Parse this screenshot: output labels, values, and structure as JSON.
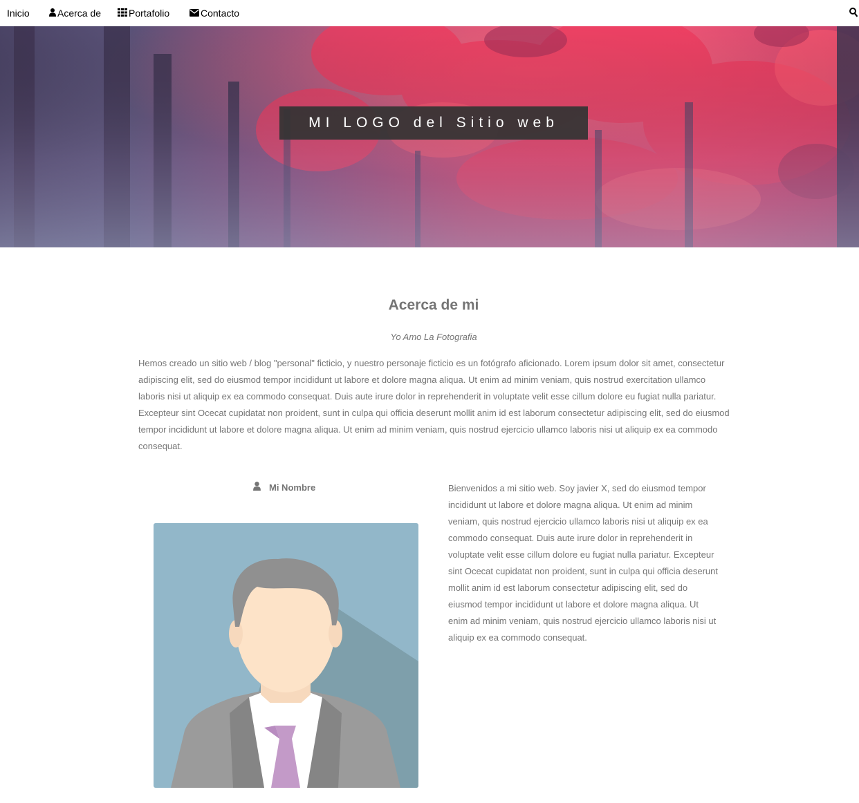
{
  "nav": {
    "items": [
      {
        "label": "Inicio",
        "icon": ""
      },
      {
        "label": "Acerca de",
        "icon": "user-icon"
      },
      {
        "label": "Portafolio",
        "icon": "grid-icon"
      },
      {
        "label": "Contacto",
        "icon": "envelope-icon"
      }
    ],
    "search_icon": "search-icon"
  },
  "hero": {
    "logo_text": "MI LOGO del Sitio web"
  },
  "about": {
    "title": "Acerca de mi",
    "subtitle": "Yo Amo La Fotografia",
    "intro": "Hemos creado un sitio web / blog \"personal\" ficticio, y nuestro personaje ficticio es un fotógrafo aficionado. Lorem ipsum dolor sit amet, consectetur adipiscing elit, sed do eiusmod tempor incididunt ut labore et dolore magna aliqua. Ut enim ad minim veniam, quis nostrud exercitation ullamco laboris nisi ut aliquip ex ea commodo consequat. Duis aute irure dolor in reprehenderit in voluptate velit esse cillum dolore eu fugiat nulla pariatur. Excepteur sint Ocecat cupidatat non proident, sunt in culpa qui officia deserunt mollit anim id est laborum consectetur adipiscing elit, sed do eiusmod tempor incididunt ut labore et dolore magna aliqua. Ut enim ad minim veniam, quis nostrud ejercicio ullamco laboris nisi ut aliquip ex ea commodo consequat.",
    "name": "Mi Nombre",
    "bio": "Bienvenidos a mi sitio web. Soy javier X, sed do eiusmod tempor incididunt ut labore et dolore magna aliqua. Ut enim ad minim veniam, quis nostrud ejercicio ullamco laboris nisi ut aliquip ex ea commodo consequat. Duis aute irure dolor in reprehenderit in voluptate velit esse cillum dolore eu fugiat nulla pariatur. Excepteur sint Ocecat cupidatat non proident, sunt in culpa qui officia deserunt mollit anim id est laborum consectetur adipiscing elit, sed do eiusmod tempor incididunt ut labore et dolore magna aliqua. Ut enim ad minim veniam, quis nostrud ejercicio ullamco laboris nisi ut aliquip ex ea commodo consequat."
  },
  "colors": {
    "text": "#757575",
    "nav_text": "#000000",
    "logo_bg": "#343434",
    "hero_red": "#e8345a",
    "hero_purple": "#5c4a72",
    "avatar_bg": "#8fb3c6",
    "tie": "#c39ac8"
  }
}
